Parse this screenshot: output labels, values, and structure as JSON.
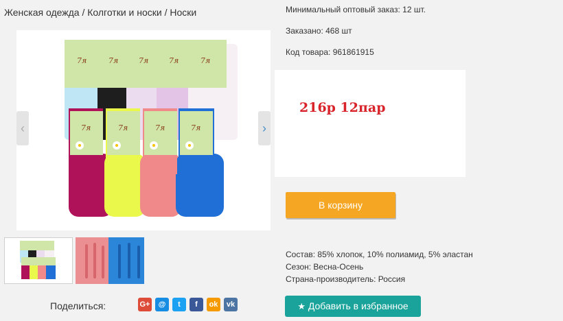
{
  "breadcrumb": "Женская одежда / Колготки и носки / Носки",
  "gallery": {
    "prev_arrow": "‹",
    "next_arrow": "›",
    "brand_label": "7я"
  },
  "info": {
    "min_order": "Минимальный оптовый заказ: 12 шт.",
    "ordered": "Заказано: 468 шт",
    "sku": "Код товара: 961861915"
  },
  "price": "216р 12пар",
  "cart_button": "В корзину",
  "properties": {
    "composition": "Состав: 85% хлопок, 10% полиамид, 5% эластан",
    "season": "Сезон: Весна-Осень",
    "country": "Страна-производитель: Россия"
  },
  "share": {
    "label": "Поделиться:",
    "icons": [
      "G+",
      "@",
      "t",
      "f",
      "ok",
      "vk"
    ],
    "colors": [
      "#dd4b39",
      "#168de2",
      "#1da1f2",
      "#3b5998",
      "#f59a00",
      "#4c75a3"
    ]
  },
  "favorite_button": "Добавить в избранное",
  "colors": {
    "cart_button": "#f5a623",
    "favorite_button": "#1aa39a",
    "price": "#d8232a"
  }
}
